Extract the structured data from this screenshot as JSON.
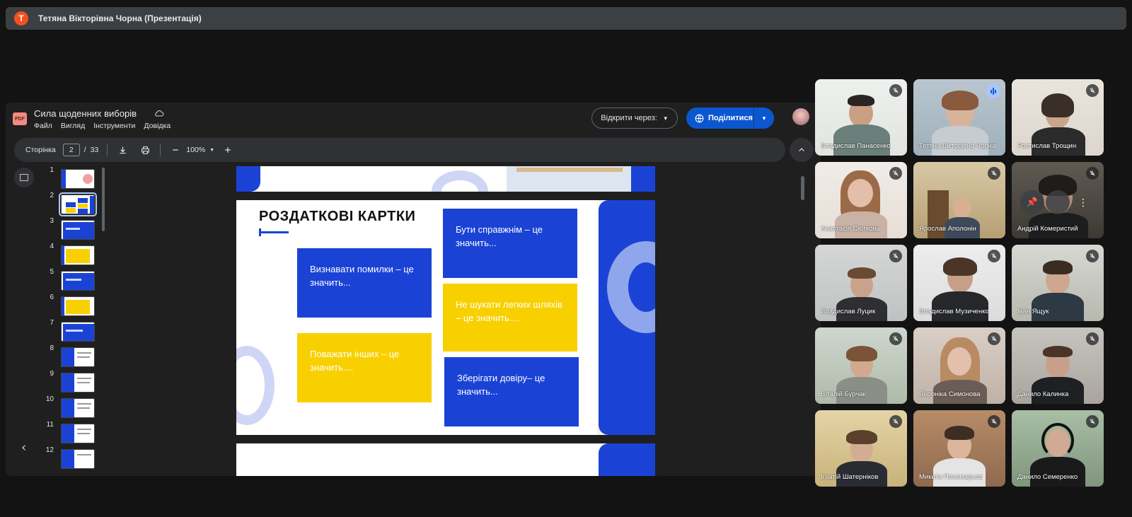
{
  "presenter": {
    "avatar_letter": "T",
    "label": "Тетяна Вікторівна Чорна (Презентація)"
  },
  "document": {
    "badge": "PDF",
    "title": "Сила щоденних виборів",
    "menu": [
      "Файл",
      "Вигляд",
      "Інструменти",
      "Довідка"
    ],
    "open_with_label": "Відкрити через:",
    "share_label": "Поділитися"
  },
  "toolbar": {
    "page_label": "Сторінка",
    "current_page": "2",
    "separator": "/",
    "total_pages": "33",
    "zoom": "100%"
  },
  "thumbnails": [
    "1",
    "2",
    "3",
    "4",
    "5",
    "6",
    "7",
    "8",
    "9",
    "10",
    "11",
    "12"
  ],
  "slide": {
    "title": "РОЗДАТКОВІ КАРТКИ",
    "cards": [
      {
        "text": "Визнавати помилки – це значить...",
        "color": "#1a43d6"
      },
      {
        "text": "Бути справжнім – це значить...",
        "color": "#1a43d6"
      },
      {
        "text": "Не шукати легких шляхів – це значить....",
        "color": "#f8d000"
      },
      {
        "text": "Поважати інших – це значить....",
        "color": "#f8d000"
      },
      {
        "text": "Зберігати довіру– це значить...",
        "color": "#1a43d6"
      }
    ]
  },
  "participants": [
    {
      "name": "Владислав Панасенко",
      "speaking": false
    },
    {
      "name": "Тетяна Вікторівна Чорна",
      "speaking": true
    },
    {
      "name": "Ростислав Трощин",
      "speaking": false
    },
    {
      "name": "Анастасія Сюткова",
      "speaking": false
    },
    {
      "name": "Ярослав Аполонін",
      "speaking": false
    },
    {
      "name": "Андрій Комеристий",
      "speaking": false
    },
    {
      "name": "Владислав Луцик",
      "speaking": false
    },
    {
      "name": "Владислав Музиченко",
      "speaking": false
    },
    {
      "name": "Іван Ящук",
      "speaking": false
    },
    {
      "name": "Віталій Бурчак",
      "speaking": false
    },
    {
      "name": "Вероніка Симонова",
      "speaking": false
    },
    {
      "name": "Данило Калинка",
      "speaking": false
    },
    {
      "name": "Ігнатій Шатерніков",
      "speaking": false
    },
    {
      "name": "Микита Пономарьов",
      "speaking": false
    },
    {
      "name": "Данило Семеренко",
      "speaking": false
    }
  ],
  "colors": {
    "accent_blue": "#0b57d0",
    "slide_blue": "#1a43d6",
    "slide_yellow": "#f8d000",
    "presenter_avatar": "#f4511e"
  }
}
